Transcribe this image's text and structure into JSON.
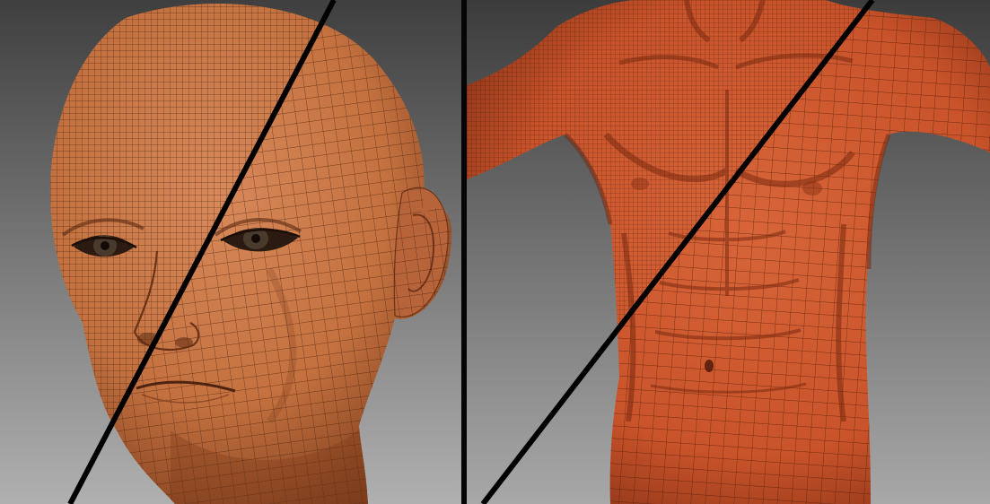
{
  "scene": {
    "type": "3d-mesh-topology-comparison",
    "panels": [
      {
        "subject": "female-head-wireframe-mesh",
        "split": "diagonal-dense-vs-retopo"
      },
      {
        "subject": "male-torso-wireframe-mesh",
        "split": "diagonal-dense-vs-retopo"
      }
    ],
    "colors": {
      "background_top": "#4a4a4a",
      "background_bottom": "#a9a9a9",
      "head_skin": "#c4713f",
      "head_skin_dark": "#8f4a24",
      "torso_skin": "#c9532a",
      "torso_skin_dark": "#8e3518",
      "wire_dense": "#3a1d0e",
      "wire_sparse": "#4a220f",
      "split_line": "#000000",
      "divider": "#050505",
      "eye_iris": "#4a3a2c"
    }
  }
}
